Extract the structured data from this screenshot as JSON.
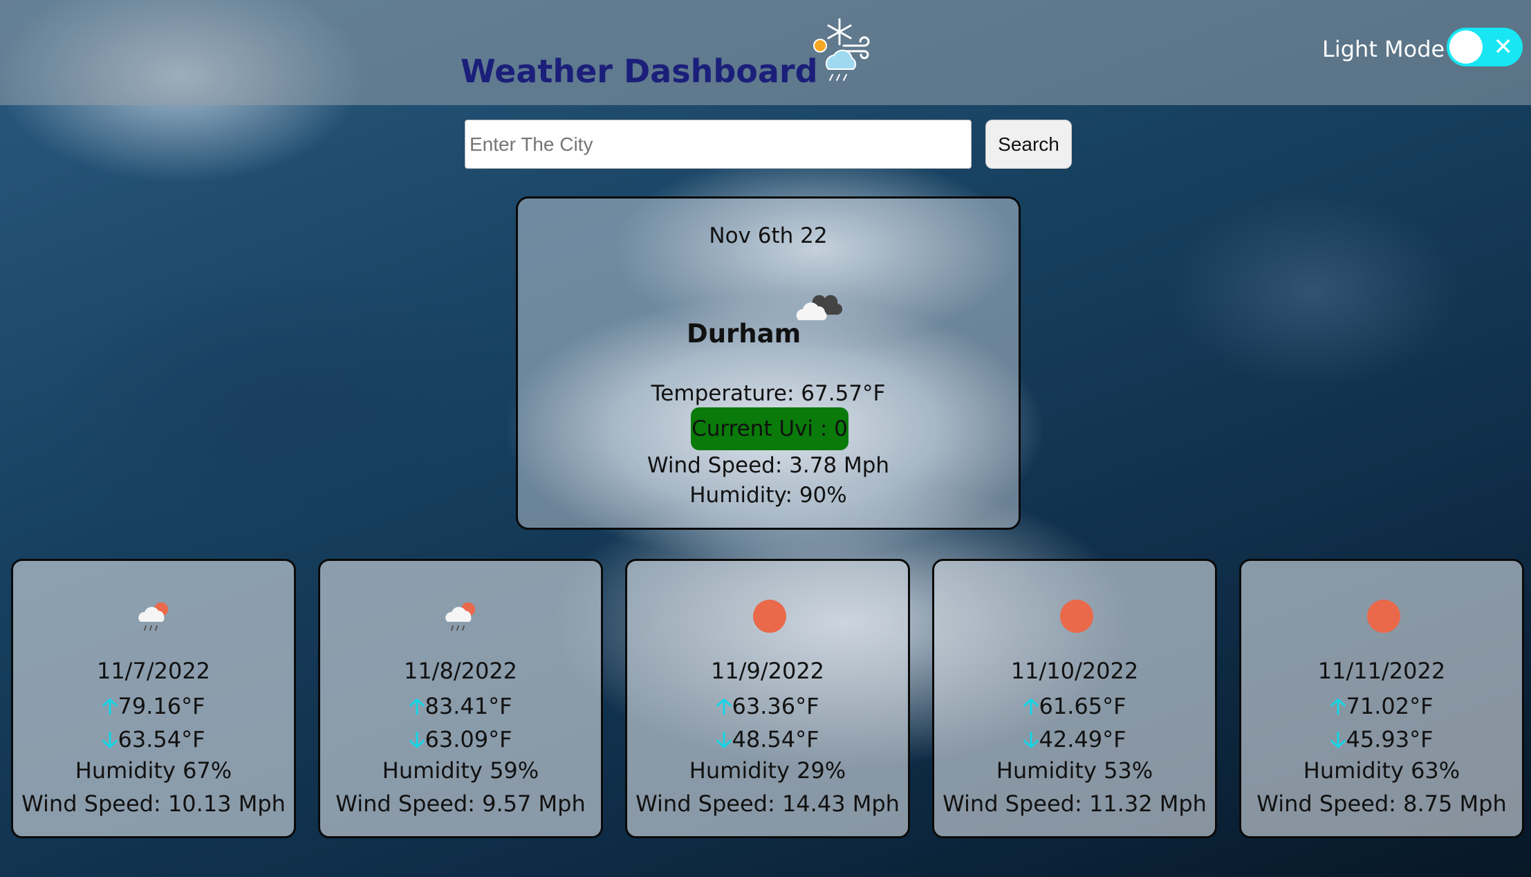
{
  "header": {
    "title": "Weather Dashboard",
    "logo_icon": "snow-sun-wind-icon",
    "mode_label": "Light Mode",
    "toggle_color": "#18e6f2"
  },
  "search": {
    "placeholder": "Enter The City",
    "value": "",
    "button_label": "Search"
  },
  "current": {
    "date": "Nov 6th 22",
    "city": "Durham",
    "icon": "cloudy-icon",
    "temperature": "Temperature: 67.57°F",
    "uvi": "Current Uvi : 0",
    "uvi_color": "#0a7a0a",
    "wind": "Wind Speed: 3.78 Mph",
    "humidity": "Humidity: 90%"
  },
  "forecast": [
    {
      "icon": "rain-sun-icon",
      "date": "11/7/2022",
      "high": "79.16°F",
      "low": "63.54°F",
      "humidity": "Humidity 67%",
      "wind": "Wind Speed: 10.13 Mph"
    },
    {
      "icon": "rain-sun-icon",
      "date": "11/8/2022",
      "high": "83.41°F",
      "low": "63.09°F",
      "humidity": "Humidity 59%",
      "wind": "Wind Speed: 9.57 Mph"
    },
    {
      "icon": "sun-icon",
      "date": "11/9/2022",
      "high": "63.36°F",
      "low": "48.54°F",
      "humidity": "Humidity 29%",
      "wind": "Wind Speed: 14.43 Mph"
    },
    {
      "icon": "sun-icon",
      "date": "11/10/2022",
      "high": "61.65°F",
      "low": "42.49°F",
      "humidity": "Humidity 53%",
      "wind": "Wind Speed: 11.32 Mph"
    },
    {
      "icon": "sun-icon",
      "date": "11/11/2022",
      "high": "71.02°F",
      "low": "45.93°F",
      "humidity": "Humidity 63%",
      "wind": "Wind Speed: 8.75 Mph"
    }
  ],
  "colors": {
    "title": "#1b1f7a",
    "arrow": "#15d6e6",
    "sun": "#e9694a"
  }
}
